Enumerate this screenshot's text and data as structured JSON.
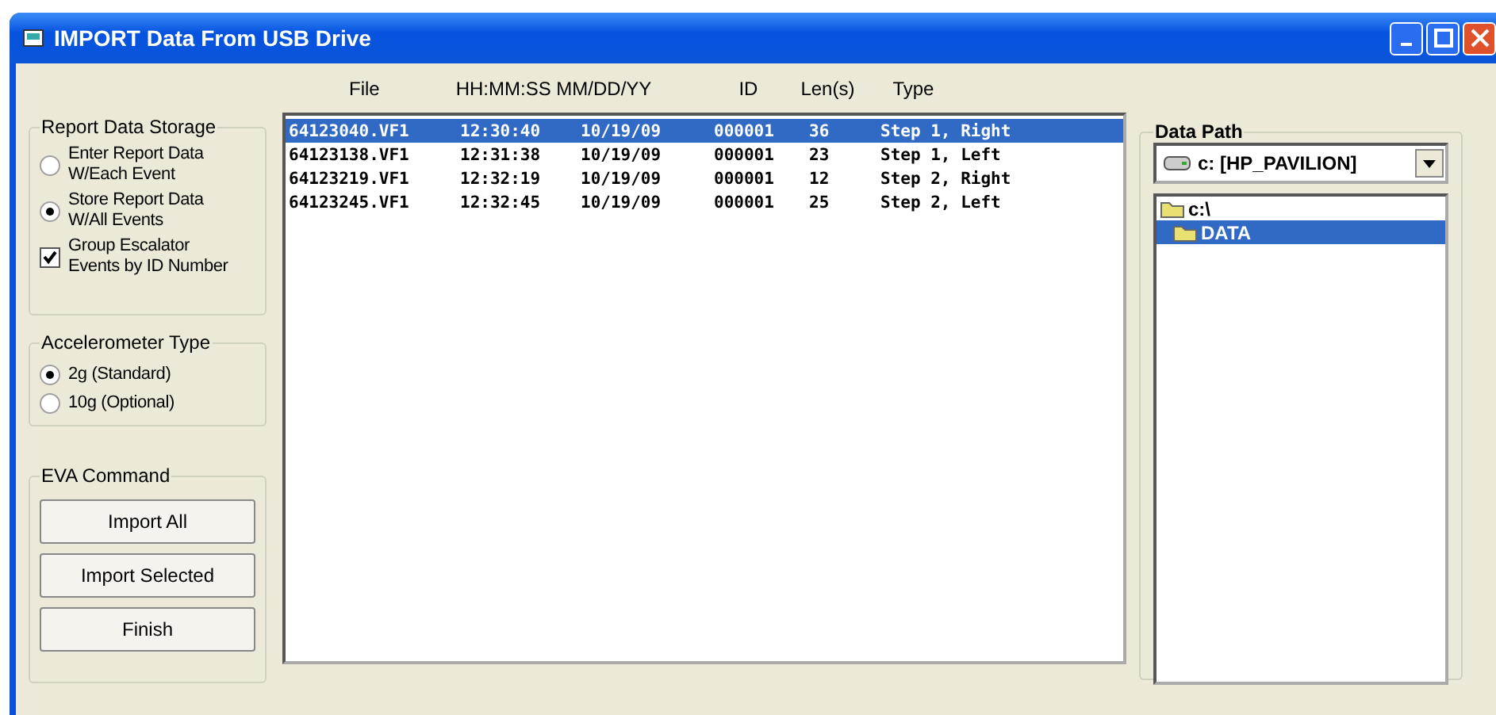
{
  "window": {
    "title": "IMPORT Data From USB Drive"
  },
  "columns": [
    "File",
    "HH:MM:SS MM/DD/YY",
    "ID",
    "Len(s)",
    "Type"
  ],
  "rows": [
    {
      "file": "64123040.VF1",
      "time": "12:30:40",
      "date": "10/19/09",
      "id": "000001",
      "len": "36",
      "type": "Step 1, Right",
      "selected": true
    },
    {
      "file": "64123138.VF1",
      "time": "12:31:38",
      "date": "10/19/09",
      "id": "000001",
      "len": "23",
      "type": "Step 1, Left",
      "selected": false
    },
    {
      "file": "64123219.VF1",
      "time": "12:32:19",
      "date": "10/19/09",
      "id": "000001",
      "len": "12",
      "type": "Step 2, Right",
      "selected": false
    },
    {
      "file": "64123245.VF1",
      "time": "12:32:45",
      "date": "10/19/09",
      "id": "000001",
      "len": "25",
      "type": "Step 2, Left",
      "selected": false
    }
  ],
  "report_storage": {
    "title": "Report Data Storage",
    "options": [
      {
        "kind": "radio",
        "label": "Enter Report Data W/Each Event",
        "checked": false
      },
      {
        "kind": "radio",
        "label": "Store Report Data W/All Events",
        "checked": true
      },
      {
        "kind": "checkbox",
        "label": "Group Escalator Events by ID Number",
        "checked": true
      }
    ]
  },
  "accelerometer": {
    "title": "Accelerometer Type",
    "options": [
      {
        "label": "2g (Standard)",
        "checked": true
      },
      {
        "label": "10g (Optional)",
        "checked": false
      }
    ]
  },
  "eva_command": {
    "title": "EVA Command",
    "buttons": [
      "Import All",
      "Import Selected",
      "Finish"
    ]
  },
  "data_path": {
    "title": "Data Path",
    "drive": "c: [HP_PAVILION]",
    "tree": [
      {
        "label": "c:\\",
        "selected": false,
        "children": [
          {
            "label": "DATA",
            "selected": true
          }
        ]
      }
    ]
  }
}
